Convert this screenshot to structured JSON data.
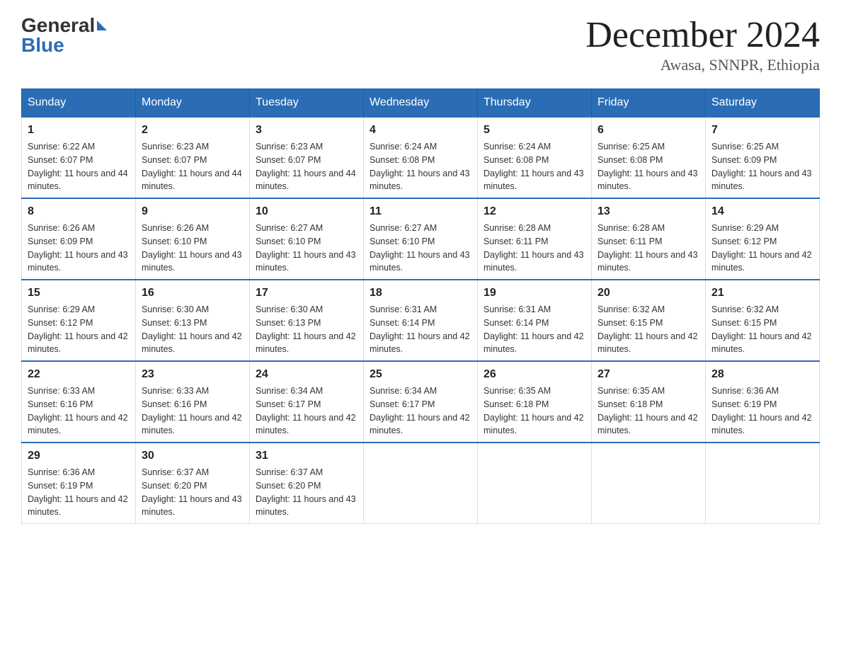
{
  "logo": {
    "general": "General",
    "blue": "Blue"
  },
  "title": "December 2024",
  "location": "Awasa, SNNPR, Ethiopia",
  "days_of_week": [
    "Sunday",
    "Monday",
    "Tuesday",
    "Wednesday",
    "Thursday",
    "Friday",
    "Saturday"
  ],
  "weeks": [
    [
      {
        "day": "1",
        "sunrise": "Sunrise: 6:22 AM",
        "sunset": "Sunset: 6:07 PM",
        "daylight": "Daylight: 11 hours and 44 minutes."
      },
      {
        "day": "2",
        "sunrise": "Sunrise: 6:23 AM",
        "sunset": "Sunset: 6:07 PM",
        "daylight": "Daylight: 11 hours and 44 minutes."
      },
      {
        "day": "3",
        "sunrise": "Sunrise: 6:23 AM",
        "sunset": "Sunset: 6:07 PM",
        "daylight": "Daylight: 11 hours and 44 minutes."
      },
      {
        "day": "4",
        "sunrise": "Sunrise: 6:24 AM",
        "sunset": "Sunset: 6:08 PM",
        "daylight": "Daylight: 11 hours and 43 minutes."
      },
      {
        "day": "5",
        "sunrise": "Sunrise: 6:24 AM",
        "sunset": "Sunset: 6:08 PM",
        "daylight": "Daylight: 11 hours and 43 minutes."
      },
      {
        "day": "6",
        "sunrise": "Sunrise: 6:25 AM",
        "sunset": "Sunset: 6:08 PM",
        "daylight": "Daylight: 11 hours and 43 minutes."
      },
      {
        "day": "7",
        "sunrise": "Sunrise: 6:25 AM",
        "sunset": "Sunset: 6:09 PM",
        "daylight": "Daylight: 11 hours and 43 minutes."
      }
    ],
    [
      {
        "day": "8",
        "sunrise": "Sunrise: 6:26 AM",
        "sunset": "Sunset: 6:09 PM",
        "daylight": "Daylight: 11 hours and 43 minutes."
      },
      {
        "day": "9",
        "sunrise": "Sunrise: 6:26 AM",
        "sunset": "Sunset: 6:10 PM",
        "daylight": "Daylight: 11 hours and 43 minutes."
      },
      {
        "day": "10",
        "sunrise": "Sunrise: 6:27 AM",
        "sunset": "Sunset: 6:10 PM",
        "daylight": "Daylight: 11 hours and 43 minutes."
      },
      {
        "day": "11",
        "sunrise": "Sunrise: 6:27 AM",
        "sunset": "Sunset: 6:10 PM",
        "daylight": "Daylight: 11 hours and 43 minutes."
      },
      {
        "day": "12",
        "sunrise": "Sunrise: 6:28 AM",
        "sunset": "Sunset: 6:11 PM",
        "daylight": "Daylight: 11 hours and 43 minutes."
      },
      {
        "day": "13",
        "sunrise": "Sunrise: 6:28 AM",
        "sunset": "Sunset: 6:11 PM",
        "daylight": "Daylight: 11 hours and 43 minutes."
      },
      {
        "day": "14",
        "sunrise": "Sunrise: 6:29 AM",
        "sunset": "Sunset: 6:12 PM",
        "daylight": "Daylight: 11 hours and 42 minutes."
      }
    ],
    [
      {
        "day": "15",
        "sunrise": "Sunrise: 6:29 AM",
        "sunset": "Sunset: 6:12 PM",
        "daylight": "Daylight: 11 hours and 42 minutes."
      },
      {
        "day": "16",
        "sunrise": "Sunrise: 6:30 AM",
        "sunset": "Sunset: 6:13 PM",
        "daylight": "Daylight: 11 hours and 42 minutes."
      },
      {
        "day": "17",
        "sunrise": "Sunrise: 6:30 AM",
        "sunset": "Sunset: 6:13 PM",
        "daylight": "Daylight: 11 hours and 42 minutes."
      },
      {
        "day": "18",
        "sunrise": "Sunrise: 6:31 AM",
        "sunset": "Sunset: 6:14 PM",
        "daylight": "Daylight: 11 hours and 42 minutes."
      },
      {
        "day": "19",
        "sunrise": "Sunrise: 6:31 AM",
        "sunset": "Sunset: 6:14 PM",
        "daylight": "Daylight: 11 hours and 42 minutes."
      },
      {
        "day": "20",
        "sunrise": "Sunrise: 6:32 AM",
        "sunset": "Sunset: 6:15 PM",
        "daylight": "Daylight: 11 hours and 42 minutes."
      },
      {
        "day": "21",
        "sunrise": "Sunrise: 6:32 AM",
        "sunset": "Sunset: 6:15 PM",
        "daylight": "Daylight: 11 hours and 42 minutes."
      }
    ],
    [
      {
        "day": "22",
        "sunrise": "Sunrise: 6:33 AM",
        "sunset": "Sunset: 6:16 PM",
        "daylight": "Daylight: 11 hours and 42 minutes."
      },
      {
        "day": "23",
        "sunrise": "Sunrise: 6:33 AM",
        "sunset": "Sunset: 6:16 PM",
        "daylight": "Daylight: 11 hours and 42 minutes."
      },
      {
        "day": "24",
        "sunrise": "Sunrise: 6:34 AM",
        "sunset": "Sunset: 6:17 PM",
        "daylight": "Daylight: 11 hours and 42 minutes."
      },
      {
        "day": "25",
        "sunrise": "Sunrise: 6:34 AM",
        "sunset": "Sunset: 6:17 PM",
        "daylight": "Daylight: 11 hours and 42 minutes."
      },
      {
        "day": "26",
        "sunrise": "Sunrise: 6:35 AM",
        "sunset": "Sunset: 6:18 PM",
        "daylight": "Daylight: 11 hours and 42 minutes."
      },
      {
        "day": "27",
        "sunrise": "Sunrise: 6:35 AM",
        "sunset": "Sunset: 6:18 PM",
        "daylight": "Daylight: 11 hours and 42 minutes."
      },
      {
        "day": "28",
        "sunrise": "Sunrise: 6:36 AM",
        "sunset": "Sunset: 6:19 PM",
        "daylight": "Daylight: 11 hours and 42 minutes."
      }
    ],
    [
      {
        "day": "29",
        "sunrise": "Sunrise: 6:36 AM",
        "sunset": "Sunset: 6:19 PM",
        "daylight": "Daylight: 11 hours and 42 minutes."
      },
      {
        "day": "30",
        "sunrise": "Sunrise: 6:37 AM",
        "sunset": "Sunset: 6:20 PM",
        "daylight": "Daylight: 11 hours and 43 minutes."
      },
      {
        "day": "31",
        "sunrise": "Sunrise: 6:37 AM",
        "sunset": "Sunset: 6:20 PM",
        "daylight": "Daylight: 11 hours and 43 minutes."
      },
      null,
      null,
      null,
      null
    ]
  ]
}
